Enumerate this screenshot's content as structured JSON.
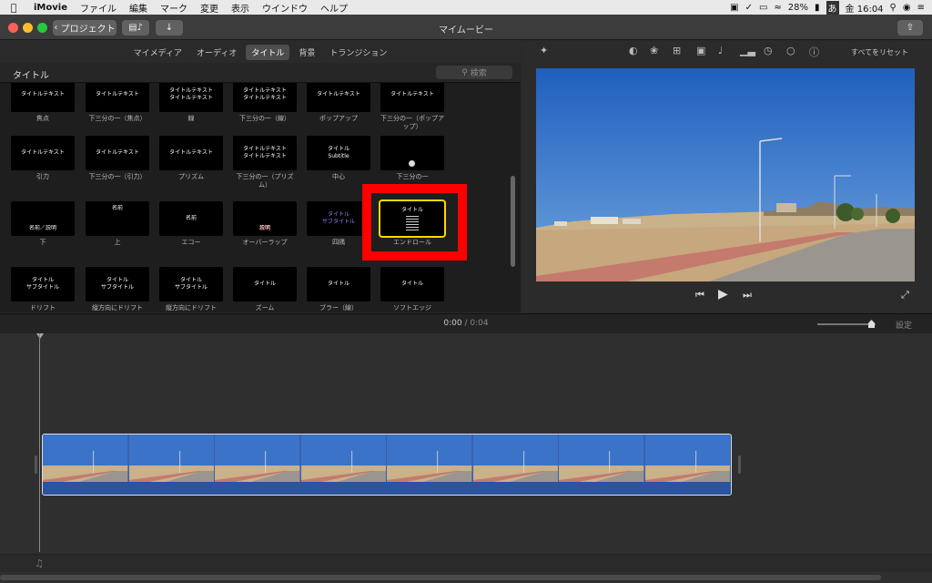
{
  "menubar": {
    "app": "iMovie",
    "items": [
      "ファイル",
      "編集",
      "マーク",
      "変更",
      "表示",
      "ウインドウ",
      "ヘルプ"
    ],
    "battery": "28%",
    "input_method": "あ",
    "clock": "金 16:04"
  },
  "titlebar": {
    "back_label": "プロジェクト",
    "title": "マイムービー"
  },
  "browser": {
    "tabs": [
      {
        "label": "マイメディア"
      },
      {
        "label": "オーディオ"
      },
      {
        "label": "タイトル"
      },
      {
        "label": "背景"
      },
      {
        "label": "トランジション"
      }
    ],
    "section_title": "タイトル",
    "search_placeholder": "検索",
    "titles": [
      {
        "name": "焦点",
        "preview": [
          "タイトルテキスト"
        ]
      },
      {
        "name": "下三分の一（焦点）",
        "preview": [
          "タイトルテキスト"
        ]
      },
      {
        "name": "線",
        "preview": [
          "タイトルテキスト",
          "タイトルテキスト"
        ]
      },
      {
        "name": "下三分の一（線）",
        "preview": [
          "タイトルテキスト",
          "タイトルテキスト"
        ]
      },
      {
        "name": "ポップアップ",
        "preview": [
          "タイトルテキスト"
        ]
      },
      {
        "name": "下三分の一（ポップアップ）",
        "preview": [
          "タイトルテキスト"
        ]
      },
      {
        "name": "引力",
        "preview": [
          "タイトルテキスト"
        ]
      },
      {
        "name": "下三分の一（引力）",
        "preview": [
          "タイトルテキスト"
        ]
      },
      {
        "name": "プリズム",
        "preview": [
          "タイトルテキスト"
        ]
      },
      {
        "name": "下三分の一（プリズム）",
        "preview": [
          "タイトルテキスト",
          "タイトルテキスト"
        ]
      },
      {
        "name": "中心",
        "preview": [
          "タイトル",
          "Subtitle"
        ]
      },
      {
        "name": "下三分の一",
        "preview": []
      },
      {
        "name": "下",
        "preview": [
          "名前／説明"
        ]
      },
      {
        "name": "上",
        "preview": [
          "名前"
        ]
      },
      {
        "name": "エコー",
        "preview": [
          "名前"
        ]
      },
      {
        "name": "オーバーラップ",
        "preview": [
          "名前",
          "説明"
        ]
      },
      {
        "name": "四隅",
        "preview": [
          "タイトル",
          "サブタイトル"
        ]
      },
      {
        "name": "エンドロール",
        "preview": [
          "タイトル"
        ]
      },
      {
        "name": "ドリフト",
        "preview": [
          "タイトル",
          "サブタイトル"
        ]
      },
      {
        "name": "縦方向にドリフト",
        "preview": [
          "タイトル",
          "サブタイトル"
        ]
      },
      {
        "name": "縦方向にドリフト",
        "preview": [
          "タイトル",
          "サブタイトル"
        ]
      },
      {
        "name": "ズーム",
        "preview": [
          "タイトル"
        ]
      },
      {
        "name": "ブラー（線）",
        "preview": [
          "タイトル"
        ]
      },
      {
        "name": "ソフトエッジ",
        "preview": [
          "タイトル"
        ]
      }
    ]
  },
  "viewer": {
    "reset_label": "すべてをリセット"
  },
  "timeline": {
    "current": "0:00",
    "separator": "/",
    "total": "0:04",
    "settings_label": "設定"
  }
}
